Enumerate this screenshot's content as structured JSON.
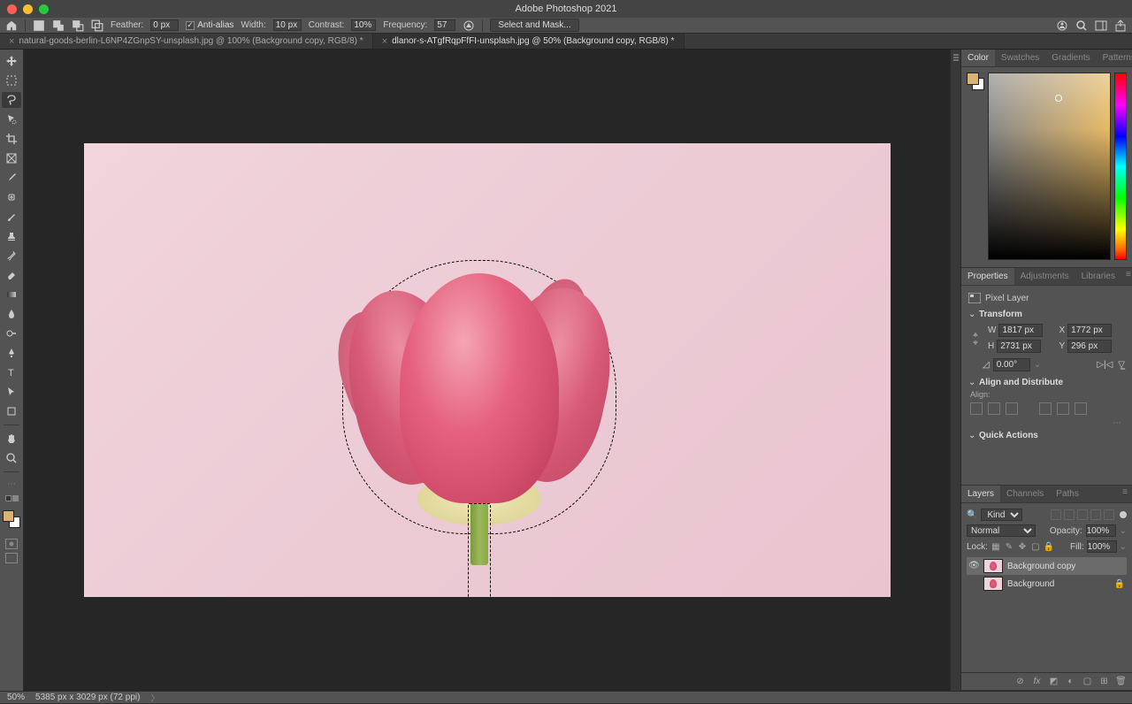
{
  "app_title": "Adobe Photoshop 2021",
  "options_bar": {
    "feather_label": "Feather:",
    "feather_value": "0 px",
    "anti_alias_label": "Anti-alias",
    "width_label": "Width:",
    "width_value": "10 px",
    "contrast_label": "Contrast:",
    "contrast_value": "10%",
    "frequency_label": "Frequency:",
    "frequency_value": "57",
    "select_mask_btn": "Select and Mask..."
  },
  "tabs": [
    {
      "label": "natural-goods-berlin-L6NP4ZGnpSY-unsplash.jpg @ 100% (Background copy, RGB/8) *",
      "active": false
    },
    {
      "label": "dlanor-s-ATgfRqpFfFI-unsplash.jpg @ 50% (Background copy, RGB/8) *",
      "active": true
    }
  ],
  "color_panel": {
    "tabs": [
      "Color",
      "Swatches",
      "Gradients",
      "Patterns"
    ],
    "active": 0
  },
  "properties_panel": {
    "tabs": [
      "Properties",
      "Adjustments",
      "Libraries"
    ],
    "active": 0,
    "type_label": "Pixel Layer",
    "transform_label": "Transform",
    "W": "1817 px",
    "H": "2731 px",
    "X": "1772 px",
    "Y": "296 px",
    "angle": "0.00°",
    "align_label": "Align and Distribute",
    "align_sub": "Align:",
    "quick_actions_label": "Quick Actions"
  },
  "layers_panel": {
    "tabs": [
      "Layers",
      "Channels",
      "Paths"
    ],
    "active": 0,
    "kind_label": "Kind",
    "blend_mode": "Normal",
    "opacity_label": "Opacity:",
    "opacity_value": "100%",
    "lock_label": "Lock:",
    "fill_label": "Fill:",
    "fill_value": "100%",
    "layers": [
      {
        "name": "Background copy",
        "visible": true,
        "selected": true,
        "locked": false
      },
      {
        "name": "Background",
        "visible": false,
        "selected": false,
        "locked": true
      }
    ]
  },
  "status": {
    "zoom": "50%",
    "dims": "5385 px x 3029 px (72 ppi)"
  }
}
